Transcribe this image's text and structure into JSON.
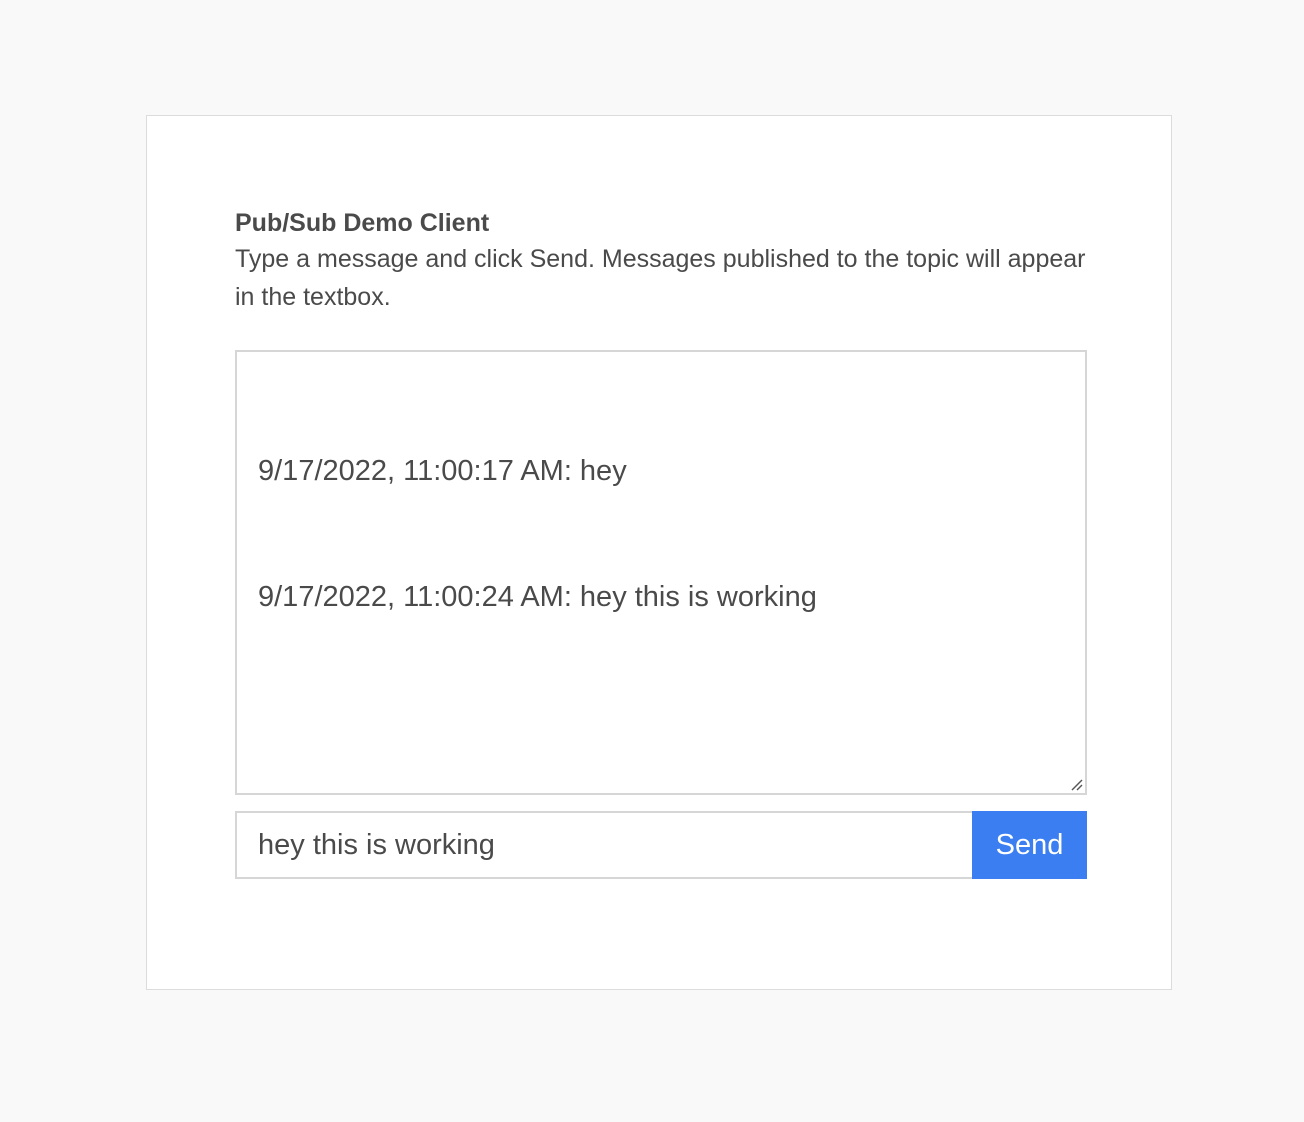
{
  "header": {
    "title": "Pub/Sub Demo Client",
    "description": "Type a message and click Send. Messages published to the topic will appear in the textbox."
  },
  "messages": [
    "9/17/2022, 11:00:17 AM: hey",
    "9/17/2022, 11:00:24 AM: hey this is working"
  ],
  "compose": {
    "input_value": "hey this is working",
    "send_label": "Send"
  },
  "colors": {
    "page_background": "#f9f9f9",
    "send_button": "#3a7ef2",
    "text": "#4a4a4a"
  }
}
